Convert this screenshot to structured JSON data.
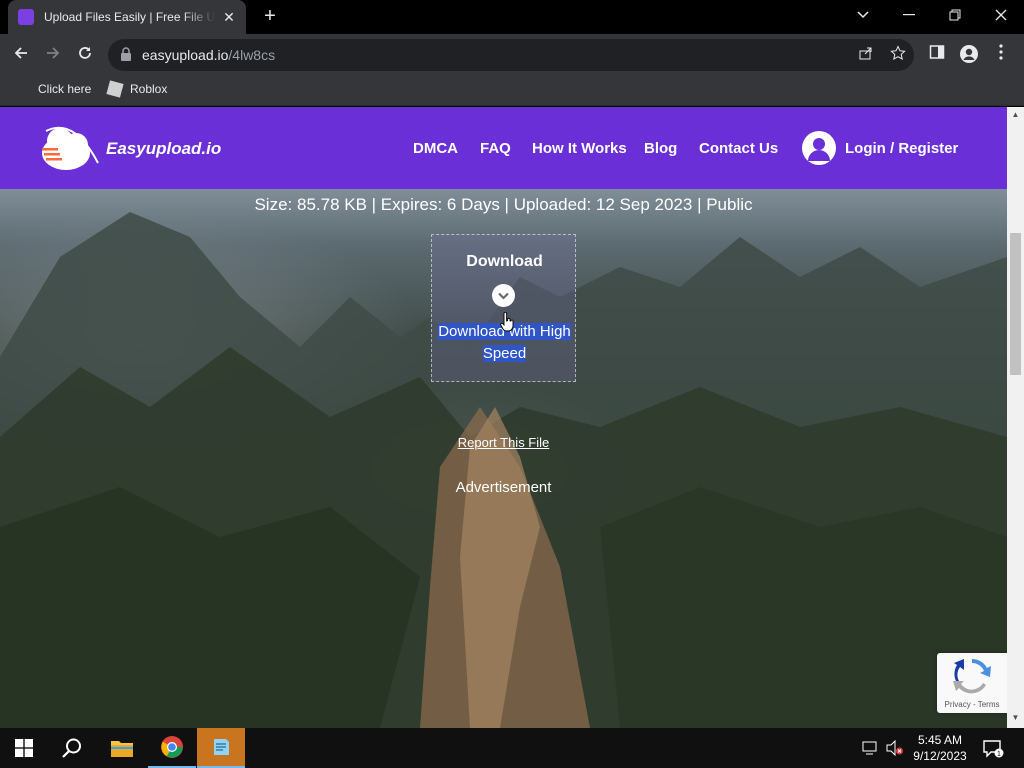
{
  "browser": {
    "tab_title": "Upload Files Easily | Free File Upload",
    "tab_close": "✕",
    "new_tab": "+",
    "url_host": "easyupload.io",
    "url_path": "/4lw8cs",
    "bookmarks": [
      "Click here",
      "Roblox"
    ]
  },
  "site": {
    "brand": "Easyupload.io",
    "nav": [
      "DMCA",
      "FAQ",
      "How It Works",
      "Blog",
      "Contact Us"
    ],
    "login": "Login / Register"
  },
  "file": {
    "info": "Size: 85.78 KB | Expires: 6 Days | Uploaded: 12 Sep 2023 | Public",
    "download_label": "Download",
    "download_high_speed": "Download with High Speed",
    "report": "Report This File",
    "advertisement": "Advertisement"
  },
  "recaptcha": {
    "text": "Privacy - Terms"
  },
  "taskbar": {
    "time": "5:45 AM",
    "date": "9/12/2023"
  },
  "colors": {
    "header_purple": "#6a2fd6",
    "chrome_dark": "#35363a",
    "highlight_blue": "#2f55c8"
  }
}
